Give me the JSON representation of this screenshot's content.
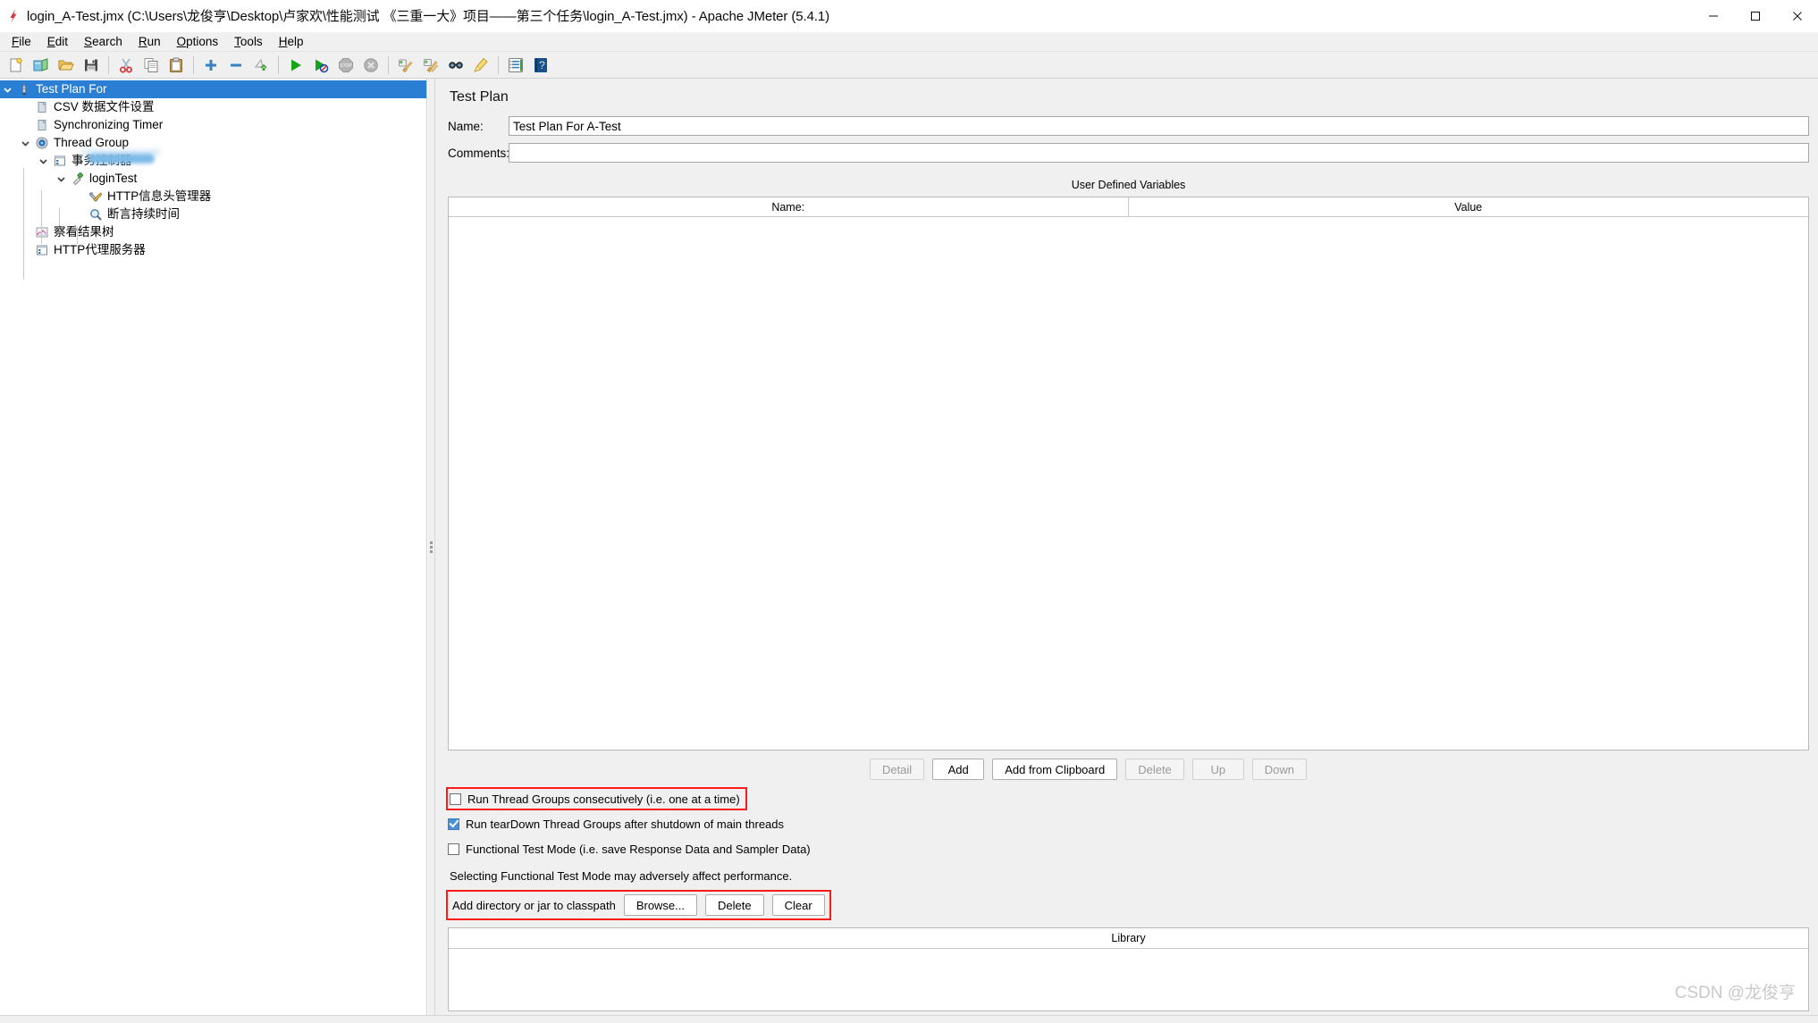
{
  "window": {
    "title": "login_A-Test.jmx (C:\\Users\\龙俊亨\\Desktop\\卢家欢\\性能测试 《三重一大》项目——第三个任务\\login_A-Test.jmx) - Apache JMeter (5.4.1)",
    "app_icon": "jmeter-feather-icon",
    "minimize_label": "–",
    "maximize_label": "□",
    "close_label": "✕"
  },
  "menubar": {
    "items": [
      {
        "label": "File",
        "mnemonic": "F",
        "rest": "ile"
      },
      {
        "label": "Edit",
        "mnemonic": "E",
        "rest": "dit"
      },
      {
        "label": "Search",
        "mnemonic": "S",
        "rest": "earch"
      },
      {
        "label": "Run",
        "mnemonic": "R",
        "rest": "un"
      },
      {
        "label": "Options",
        "mnemonic": "O",
        "rest": "ptions"
      },
      {
        "label": "Tools",
        "mnemonic": "T",
        "rest": "ools"
      },
      {
        "label": "Help",
        "mnemonic": "H",
        "rest": "elp"
      }
    ]
  },
  "toolbar": {
    "buttons": [
      {
        "name": "new-icon",
        "tip": "New"
      },
      {
        "name": "templates-icon",
        "tip": "Templates"
      },
      {
        "name": "open-icon",
        "tip": "Open"
      },
      {
        "name": "save-icon",
        "tip": "Save Test Plan"
      },
      {
        "name": "separator",
        "tip": ""
      },
      {
        "name": "cut-icon",
        "tip": "Cut"
      },
      {
        "name": "copy-icon",
        "tip": "Copy"
      },
      {
        "name": "paste-icon",
        "tip": "Paste"
      },
      {
        "name": "separator",
        "tip": ""
      },
      {
        "name": "expand-all-icon",
        "tip": "Expand All"
      },
      {
        "name": "collapse-all-icon",
        "tip": "Collapse All"
      },
      {
        "name": "toggle-icon",
        "tip": "Toggle"
      },
      {
        "name": "separator",
        "tip": ""
      },
      {
        "name": "start-icon",
        "tip": "Start"
      },
      {
        "name": "start-no-pauses-icon",
        "tip": "Start no pauses"
      },
      {
        "name": "stop-icon",
        "tip": "Stop"
      },
      {
        "name": "shutdown-icon",
        "tip": "Shutdown"
      },
      {
        "name": "separator",
        "tip": ""
      },
      {
        "name": "clear-icon",
        "tip": "Clear"
      },
      {
        "name": "clear-all-icon",
        "tip": "Clear All"
      },
      {
        "name": "search-icon",
        "tip": "Search"
      },
      {
        "name": "reset-search-icon",
        "tip": "Reset Search"
      },
      {
        "name": "separator",
        "tip": ""
      },
      {
        "name": "function-helper-icon",
        "tip": "Function Helper Dialog"
      },
      {
        "name": "help-icon",
        "tip": "Help"
      }
    ]
  },
  "tree": {
    "nodes": [
      {
        "label": "Test Plan For",
        "icon": "test-plan-icon",
        "depth": 0,
        "expanded": true,
        "selected": true,
        "redacted": true,
        "name": "tree-node-test-plan"
      },
      {
        "label": "CSV 数据文件设置",
        "icon": "csv-data-set-icon",
        "depth": 1,
        "expanded": null,
        "selected": false,
        "name": "tree-node-csv-data-set"
      },
      {
        "label": "Synchronizing Timer",
        "icon": "timer-icon",
        "depth": 1,
        "expanded": null,
        "selected": false,
        "name": "tree-node-synchronizing-timer"
      },
      {
        "label": "Thread Group",
        "icon": "thread-group-icon",
        "depth": 1,
        "expanded": true,
        "selected": false,
        "name": "tree-node-thread-group"
      },
      {
        "label": "事务控制器",
        "icon": "transaction-controller-icon",
        "depth": 2,
        "expanded": true,
        "selected": false,
        "name": "tree-node-transaction-controller"
      },
      {
        "label": "loginTest",
        "icon": "http-sampler-icon",
        "depth": 3,
        "expanded": true,
        "selected": false,
        "name": "tree-node-login-test"
      },
      {
        "label": "HTTP信息头管理器",
        "icon": "header-manager-icon",
        "depth": 4,
        "expanded": null,
        "selected": false,
        "name": "tree-node-http-header-manager"
      },
      {
        "label": "断言持续时间",
        "icon": "duration-assertion-icon",
        "depth": 4,
        "expanded": null,
        "selected": false,
        "name": "tree-node-duration-assertion"
      },
      {
        "label": "察看结果树",
        "icon": "view-results-tree-icon",
        "depth": 1,
        "expanded": null,
        "selected": false,
        "name": "tree-node-view-results-tree"
      },
      {
        "label": "HTTP代理服务器",
        "icon": "http-proxy-server-icon",
        "depth": 1,
        "expanded": null,
        "selected": false,
        "name": "tree-node-http-proxy-server"
      }
    ]
  },
  "panel": {
    "title": "Test Plan",
    "name_label": "Name:",
    "name_value": "Test Plan For A-Test",
    "comments_label": "Comments:",
    "comments_value": "",
    "udv_title": "User Defined Variables",
    "udv_columns": [
      "Name:",
      "Value"
    ],
    "udv_rows": [],
    "buttons": [
      {
        "label": "Detail",
        "enabled": false,
        "name": "detail-button"
      },
      {
        "label": "Add",
        "enabled": true,
        "name": "add-button"
      },
      {
        "label": "Add from Clipboard",
        "enabled": true,
        "name": "add-from-clipboard-button"
      },
      {
        "label": "Delete",
        "enabled": false,
        "name": "delete-variable-button"
      },
      {
        "label": "Up",
        "enabled": false,
        "name": "up-button"
      },
      {
        "label": "Down",
        "enabled": false,
        "name": "down-button"
      }
    ],
    "checkboxes": [
      {
        "label": "Run Thread Groups consecutively (i.e. one at a time)",
        "checked": false,
        "highlighted": true,
        "name": "run-thread-groups-consecutively-checkbox"
      },
      {
        "label": "Run tearDown Thread Groups after shutdown of main threads",
        "checked": true,
        "highlighted": false,
        "name": "run-teardown-thread-groups-checkbox"
      },
      {
        "label": "Functional Test Mode (i.e. save Response Data and Sampler Data)",
        "checked": false,
        "highlighted": false,
        "name": "functional-test-mode-checkbox"
      }
    ],
    "performance_note": "Selecting Functional Test Mode may adversely affect performance.",
    "classpath_label": "Add directory or jar to classpath",
    "classpath_buttons": [
      {
        "label": "Browse...",
        "name": "browse-button"
      },
      {
        "label": "Delete",
        "name": "delete-classpath-button"
      },
      {
        "label": "Clear",
        "name": "clear-classpath-button"
      }
    ],
    "library_title": "Library",
    "library_rows": []
  },
  "watermark": "CSDN @龙俊亨",
  "colors": {
    "selection": "#2a7fd4",
    "highlight_outline": "#ff1a1a",
    "checkbox_checked": "#4a90d9",
    "panel_bg": "#f0f0f0"
  }
}
